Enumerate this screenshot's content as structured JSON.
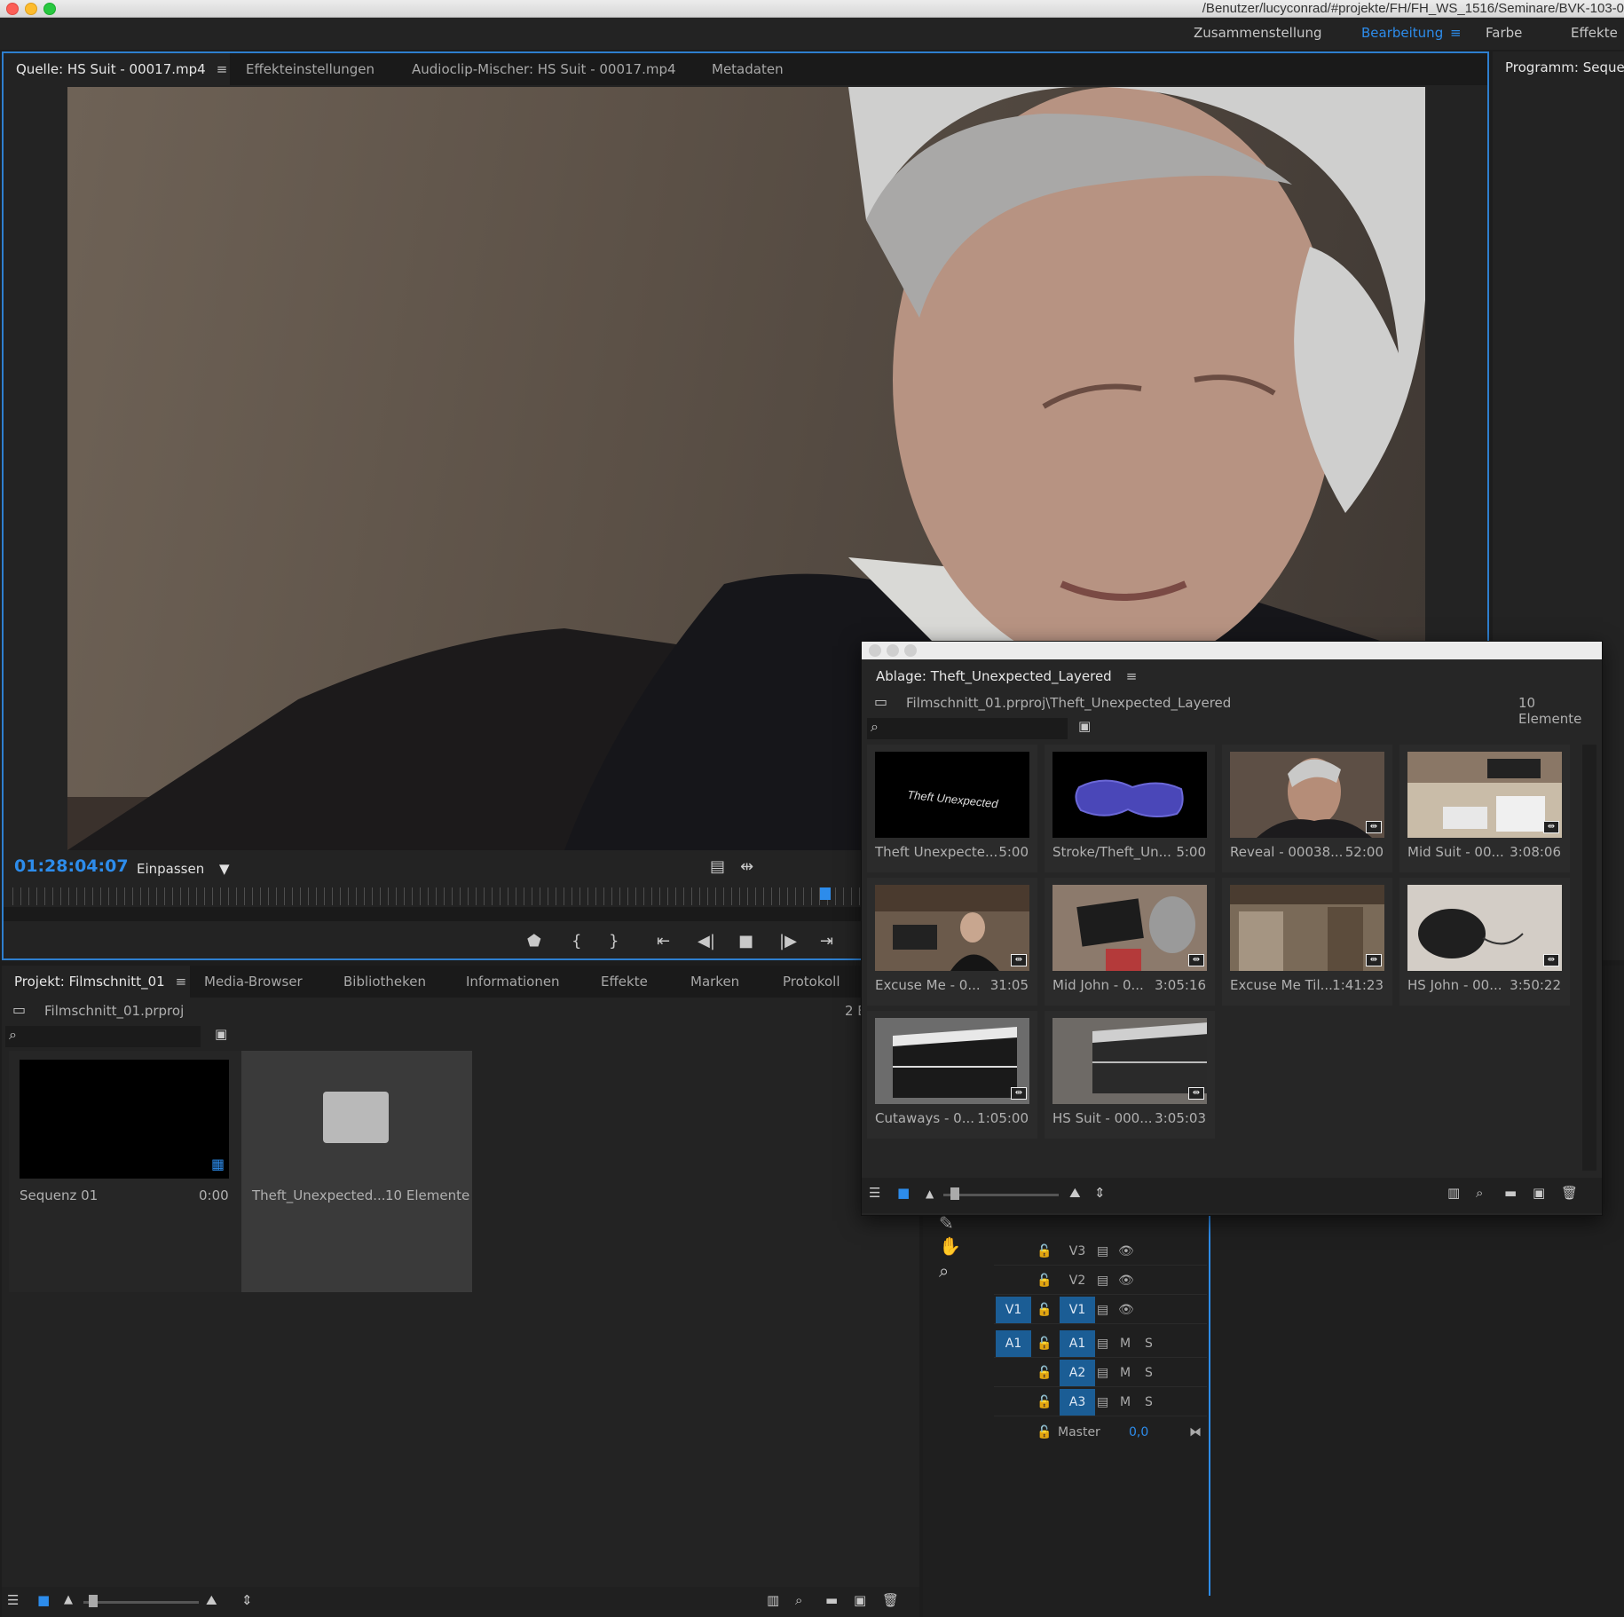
{
  "window": {
    "path": "/Benutzer/lucyconrad/#projekte/FH/FH_WS_1516/Seminare/BVK-103-0"
  },
  "workspaces": {
    "items": [
      "Zusammenstellung",
      "Bearbeitung",
      "Farbe",
      "Effekte"
    ],
    "active": "Bearbeitung",
    "menu_glyph": "≡"
  },
  "source_panel": {
    "tabs": [
      "Quelle: HS Suit - 00017.mp4",
      "Effekteinstellungen",
      "Audioclip-Mischer: HS Suit - 00017.mp4",
      "Metadaten"
    ],
    "menu_glyph": "≡",
    "timecode": "01:28:04:07",
    "zoom": "Einpassen"
  },
  "program_panel": {
    "tab": "Programm: Sequen"
  },
  "project_panel": {
    "tabs": [
      "Projekt: Filmschnitt_01",
      "Media-Browser",
      "Bibliotheken",
      "Informationen",
      "Effekte",
      "Marken",
      "Protokoll"
    ],
    "menu_glyph": "≡",
    "project_file": "Filmschnitt_01.prproj",
    "count_partial": "2 E",
    "items": [
      {
        "name": "Sequenz 01",
        "meta": "0:00"
      },
      {
        "name": "Theft_Unexpected...",
        "meta": "10 Elemente"
      }
    ]
  },
  "bin": {
    "title": "Ablage: Theft_Unexpected_Layered",
    "menu_glyph": "≡",
    "path": "Filmschnitt_01.prproj\\Theft_Unexpected_Layered",
    "count": "10 Elemente",
    "title_card_text": "Theft Unexpected",
    "clips": [
      {
        "name": "Theft Unexpecte...",
        "duration": "5:00",
        "thumb": "title-card"
      },
      {
        "name": "Stroke/Theft_Un...",
        "duration": "5:00",
        "thumb": "blue-stroke"
      },
      {
        "name": "Reveal - 00038...",
        "duration": "52:00",
        "thumb": "man-face"
      },
      {
        "name": "Mid Suit - 00...",
        "duration": "3:08:06",
        "thumb": "table-clapper"
      },
      {
        "name": "Excuse Me - 0...",
        "duration": "31:05",
        "thumb": "man-clapper"
      },
      {
        "name": "Mid John - 0...",
        "duration": "3:05:16",
        "thumb": "clapper-man"
      },
      {
        "name": "Excuse Me Til...",
        "duration": "1:41:23",
        "thumb": "room"
      },
      {
        "name": "HS John - 00...",
        "duration": "3:50:22",
        "thumb": "dark-object"
      },
      {
        "name": "Cutaways - 0...",
        "duration": "1:05:00",
        "thumb": "clapper-close"
      },
      {
        "name": "HS Suit - 000...",
        "duration": "3:05:03",
        "thumb": "clapper-blur"
      }
    ]
  },
  "timeline": {
    "video_tracks": [
      {
        "source": "",
        "label": "V3"
      },
      {
        "source": "",
        "label": "V2"
      },
      {
        "source": "V1",
        "label": "V1"
      }
    ],
    "audio_tracks": [
      {
        "source": "A1",
        "label": "A1",
        "m": "M",
        "s": "S"
      },
      {
        "source": "",
        "label": "A2",
        "m": "M",
        "s": "S"
      },
      {
        "source": "",
        "label": "A3",
        "m": "M",
        "s": "S"
      }
    ],
    "master_label": "Master",
    "master_value": "0,0"
  },
  "colors": {
    "accent": "#2d8ceb",
    "track_blue": "#1b5d95",
    "panel": "#232323",
    "background": "#1d1d1d"
  }
}
